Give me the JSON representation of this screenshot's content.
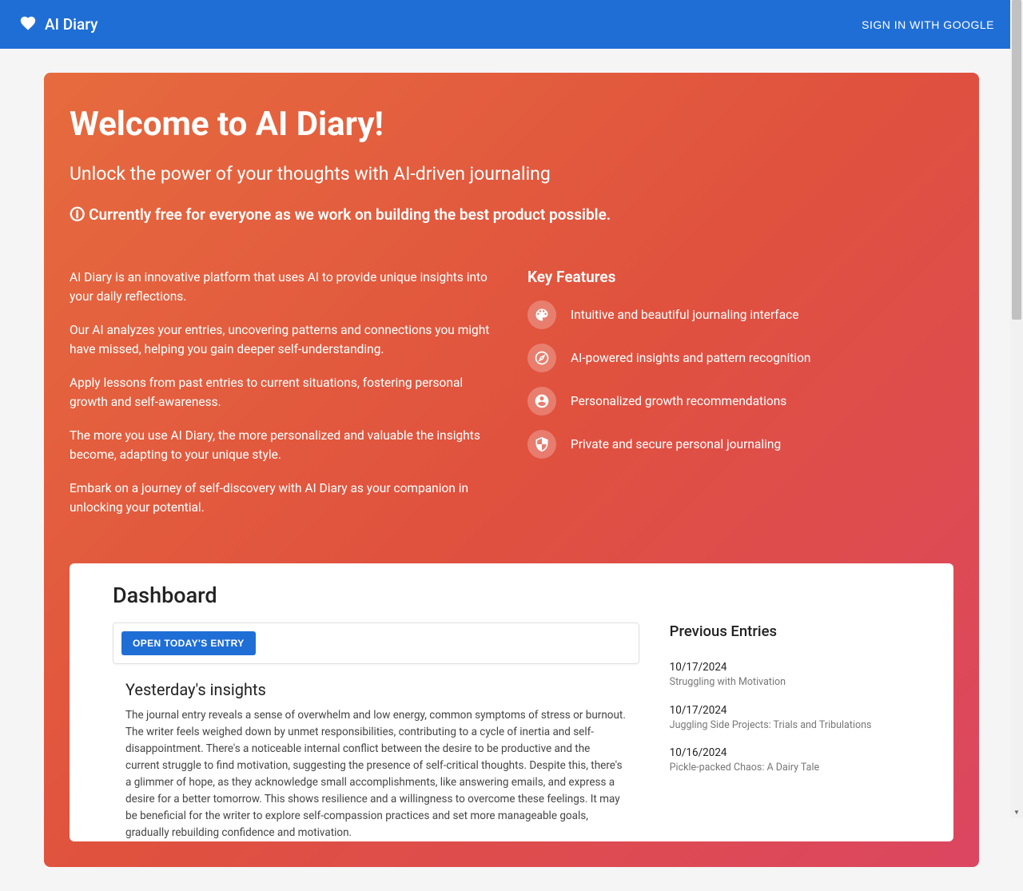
{
  "header": {
    "app_name": "AI Diary",
    "signin_label": "SIGN IN WITH GOOGLE"
  },
  "hero": {
    "title": "Welcome to AI Diary!",
    "subtitle": "Unlock the power of your thoughts with AI-driven journaling",
    "pricing_note": "🛈 Currently free for everyone as we work on building the best product possible.",
    "paragraphs": [
      "AI Diary is an innovative platform that uses AI to provide unique insights into your daily reflections.",
      "Our AI analyzes your entries, uncovering patterns and connections you might have missed, helping you gain deeper self-understanding.",
      "Apply lessons from past entries to current situations, fostering personal growth and self-awareness.",
      "The more you use AI Diary, the more personalized and valuable the insights become, adapting to your unique style.",
      "Embark on a journey of self-discovery with AI Diary as your companion in unlocking your potential."
    ],
    "features_title": "Key Features",
    "features": [
      {
        "icon": "palette",
        "text": "Intuitive and beautiful journaling interface"
      },
      {
        "icon": "compass",
        "text": "AI-powered insights and pattern recognition"
      },
      {
        "icon": "person",
        "text": "Personalized growth recommendations"
      },
      {
        "icon": "shield",
        "text": "Private and secure personal journaling"
      }
    ]
  },
  "dashboard": {
    "title": "Dashboard",
    "open_entry_label": "OPEN TODAY'S ENTRY",
    "insights_title": "Yesterday's insights",
    "insights_body": "The journal entry reveals a sense of overwhelm and low energy, common symptoms of stress or burnout. The writer feels weighed down by unmet responsibilities, contributing to a cycle of inertia and self-disappointment. There's a noticeable internal conflict between the desire to be productive and the current struggle to find motivation, suggesting the presence of self-critical thoughts. Despite this, there's a glimmer of hope, as they acknowledge small accomplishments, like answering emails, and express a desire for a better tomorrow. This shows resilience and a willingness to overcome these feelings. It may be beneficial for the writer to explore self-compassion practices and set more manageable goals, gradually rebuilding confidence and motivation.",
    "previous_entries_title": "Previous Entries",
    "entries": [
      {
        "date": "10/17/2024",
        "title": "Struggling with Motivation"
      },
      {
        "date": "10/17/2024",
        "title": "Juggling Side Projects: Trials and Tribulations"
      },
      {
        "date": "10/16/2024",
        "title": "Pickle-packed Chaos: A Dairy Tale"
      }
    ]
  }
}
